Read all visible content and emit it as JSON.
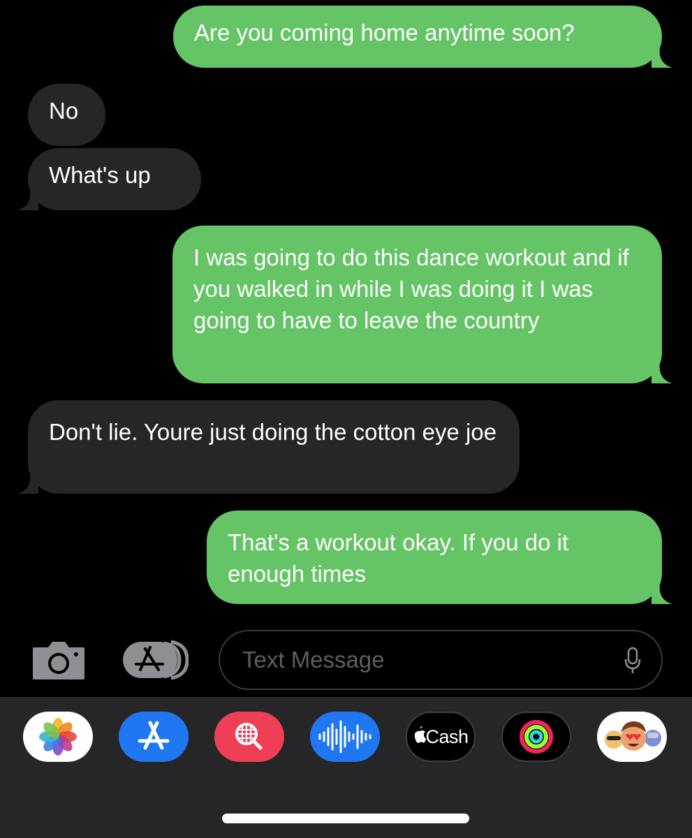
{
  "conversation": {
    "messages": [
      {
        "direction": "sent",
        "text": "Are you coming home anytime soon?"
      },
      {
        "direction": "received",
        "text": "No"
      },
      {
        "direction": "received",
        "text": "What's up"
      },
      {
        "direction": "sent",
        "text": "I was going to do this dance workout and if you walked in while I was doing it I was going to have to leave the country"
      },
      {
        "direction": "received",
        "text": "Don't lie. Youre just doing the cotton eye joe"
      },
      {
        "direction": "sent",
        "text": "That's a workout okay. If you do it enough times"
      }
    ]
  },
  "input_bar": {
    "placeholder": "Text Message",
    "icons": [
      "camera-icon",
      "app-store-icon",
      "microphone-icon"
    ]
  },
  "app_drawer": {
    "apps": [
      {
        "name": "photos-icon"
      },
      {
        "name": "app-store-icon"
      },
      {
        "name": "image-search-icon"
      },
      {
        "name": "audio-message-icon"
      },
      {
        "name": "apple-cash-icon",
        "label": "Cash"
      },
      {
        "name": "fitness-activity-icon"
      },
      {
        "name": "memoji-icon"
      }
    ]
  },
  "colors": {
    "background": "#000000",
    "sent_bubble": "#65c466",
    "received_bubble": "#262628",
    "drawer": "#262628",
    "placeholder": "#5e5e62"
  }
}
